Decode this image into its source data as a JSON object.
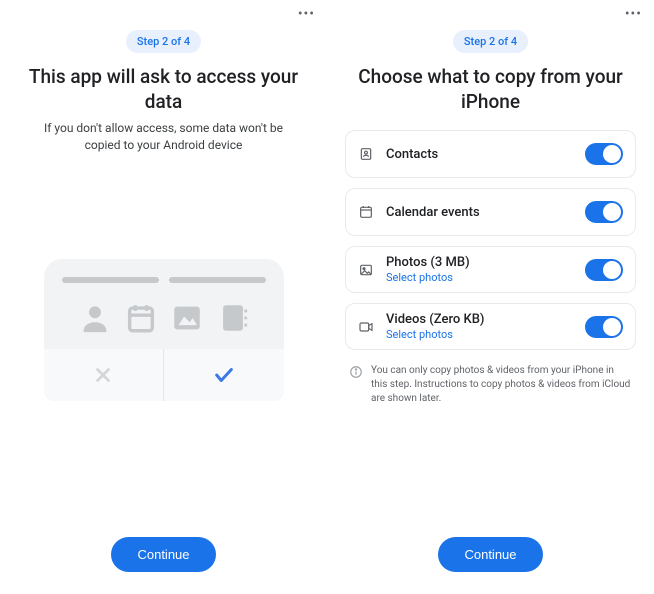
{
  "left": {
    "step_badge": "Step 2 of 4",
    "title": "This app will ask to access your data",
    "subtitle": "If you don't allow access, some data won't be copied to your Android device",
    "continue_label": "Continue"
  },
  "right": {
    "step_badge": "Step 2 of 4",
    "title": "Choose what to copy from your iPhone",
    "items": [
      {
        "label": "Contacts",
        "toggle": true
      },
      {
        "label": "Calendar events",
        "toggle": true
      },
      {
        "label": "Photos (3 MB)",
        "sublabel": "Select photos",
        "toggle": true
      },
      {
        "label": "Videos (Zero KB)",
        "sublabel": "Select photos",
        "toggle": true
      }
    ],
    "info_text": "You can only copy photos & videos from your iPhone in this step. Instructions to copy photos & videos from iCloud are shown later.",
    "continue_label": "Continue"
  }
}
